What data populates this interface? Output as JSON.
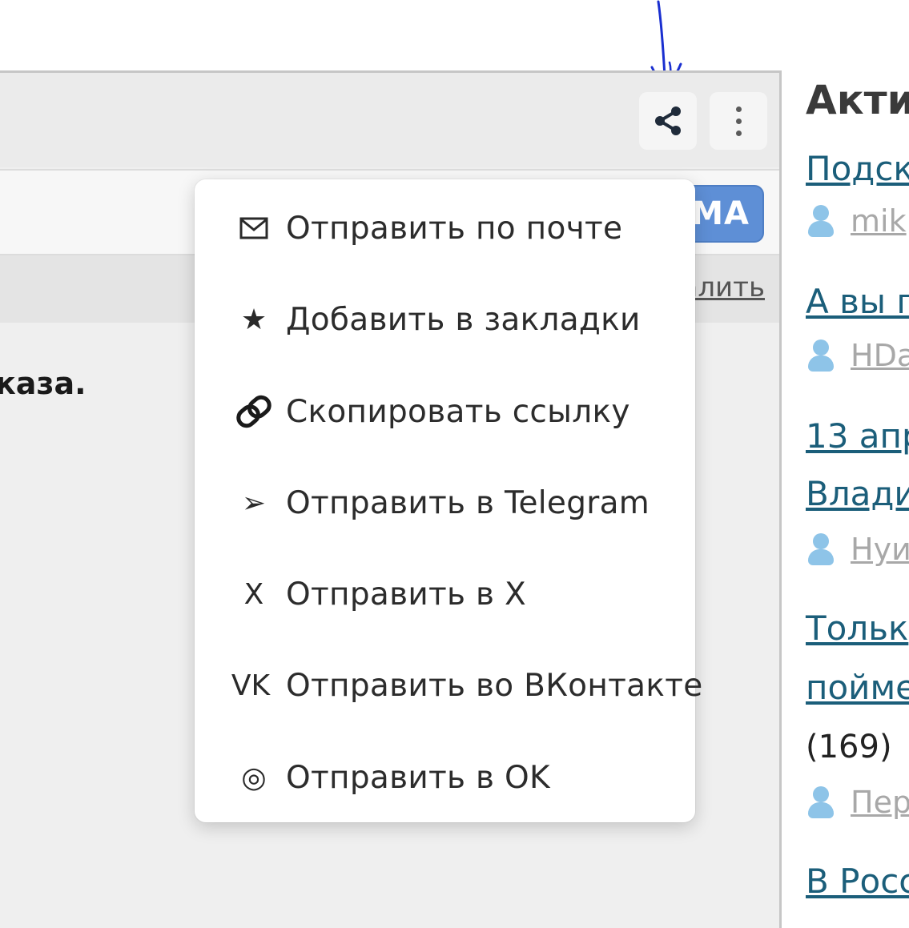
{
  "toolbar": {
    "share_icon": "share-icon",
    "more_icon": "more-vertical-icon"
  },
  "subbar": {
    "subscribe_fragment": "МА"
  },
  "delete_fragment": "алить",
  "body_fragment": "каза.",
  "menu": {
    "items": [
      {
        "icon": "mail-icon",
        "label": "Отправить по почте"
      },
      {
        "icon": "star-icon",
        "icon_text": "★",
        "label": "Добавить в закладки"
      },
      {
        "icon": "link-icon",
        "label": "Скопировать ссылку"
      },
      {
        "icon": "telegram-arrow-icon",
        "icon_text": "➢",
        "label": "Отправить в Telegram"
      },
      {
        "icon": "x-icon",
        "icon_text": "X",
        "label": "Отправить в X"
      },
      {
        "icon": "vk-icon",
        "icon_text": "VK",
        "label": "Отправить во ВКонтакте"
      },
      {
        "icon": "ok-icon",
        "icon_text": "◎",
        "label": "Отправить в OK"
      }
    ]
  },
  "sidebar": {
    "title": "Акти",
    "entries": [
      {
        "link": "Подск",
        "author": "mik"
      },
      {
        "link": "А вы г",
        "author": "HDa"
      },
      {
        "link": "13 апр",
        "link2": "Влади",
        "author": "Нуи"
      },
      {
        "link": "Тольк",
        "link2": "пойме",
        "count": "(169)",
        "author": "Пер"
      },
      {
        "link": "В Росс"
      }
    ]
  },
  "colors": {
    "accent_blue": "#5e8fd6",
    "link": "#1b5e7a",
    "annotation": "#1a2fd0"
  }
}
